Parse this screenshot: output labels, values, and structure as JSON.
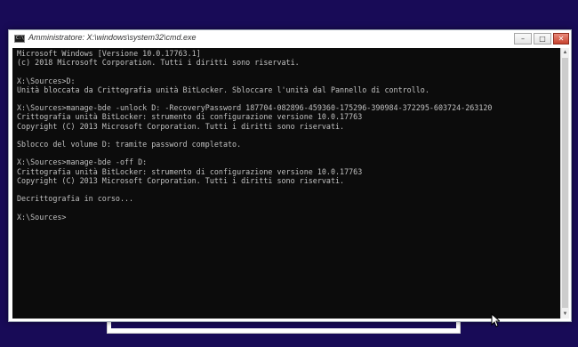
{
  "window": {
    "title": "Amministratore: X:\\windows\\system32\\cmd.exe",
    "icon_glyph": "C:\\",
    "minimize_glyph": "–",
    "maximize_glyph": "□",
    "close_glyph": "✕"
  },
  "console": {
    "lines": [
      "Microsoft Windows [Versione 10.0.17763.1]",
      "(c) 2018 Microsoft Corporation. Tutti i diritti sono riservati.",
      "",
      "X:\\Sources>D:",
      "Unità bloccata da Crittografia unità BitLocker. Sbloccare l'unità dal Pannello di controllo.",
      "",
      "X:\\Sources>manage-bde -unlock D: -RecoveryPassword 187704-082896-459360-175296-390984-372295-603724-263120",
      "Crittografia unità BitLocker: strumento di configurazione versione 10.0.17763",
      "Copyright (C) 2013 Microsoft Corporation. Tutti i diritti sono riservati.",
      "",
      "Sblocco del volume D: tramite password completato.",
      "",
      "X:\\Sources>manage-bde -off D:",
      "Crittografia unità BitLocker: strumento di configurazione versione 10.0.17763",
      "Copyright (C) 2013 Microsoft Corporation. Tutti i diritti sono riservati.",
      "",
      "Decrittografia in corso...",
      "",
      "X:\\Sources>"
    ]
  },
  "scrollbar": {
    "up_glyph": "▲",
    "down_glyph": "▼"
  },
  "colors": {
    "desktop_background": "#180b57",
    "console_background": "#0c0c0c",
    "console_text": "#c0c0c0",
    "close_button": "#c7432f"
  },
  "icons": {
    "window_icon": "cmd-icon",
    "pointer": "mouse-pointer-icon"
  }
}
